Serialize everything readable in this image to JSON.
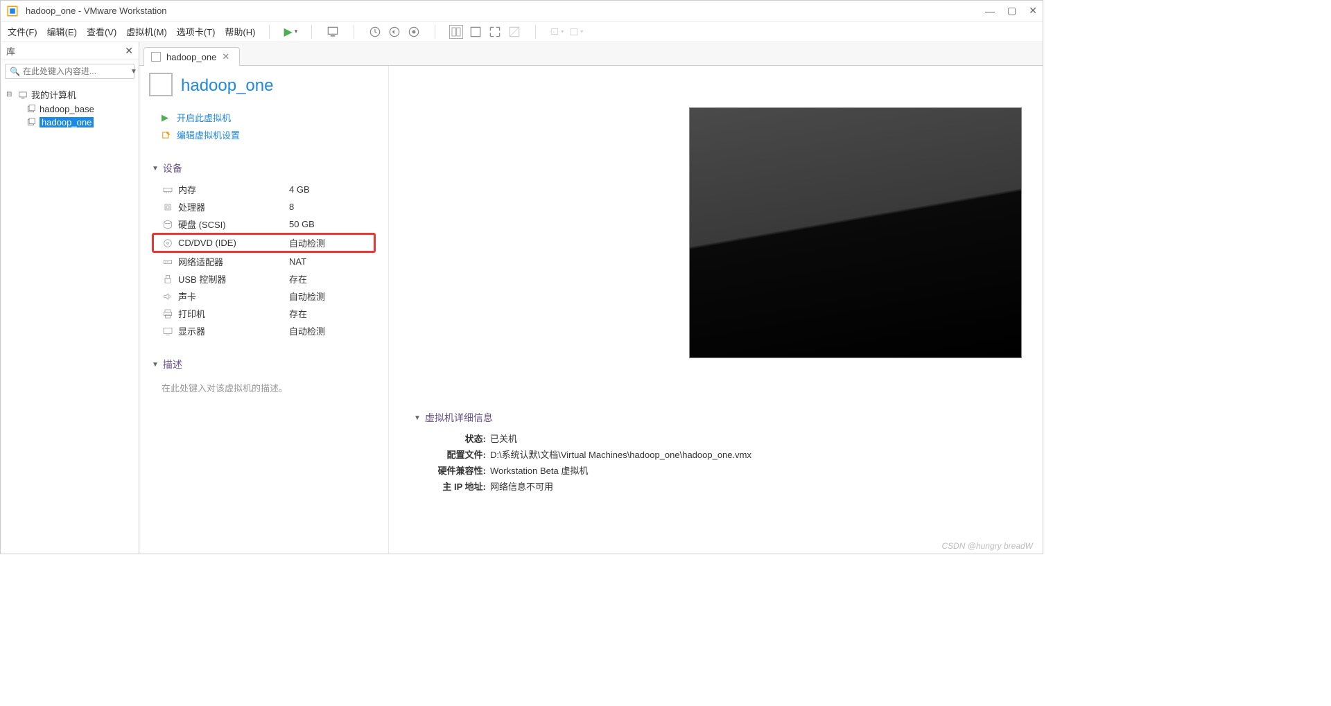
{
  "titlebar": {
    "app_title": "hadoop_one - VMware Workstation"
  },
  "menu": {
    "file": "文件(F)",
    "edit": "编辑(E)",
    "view": "查看(V)",
    "vm": "虚拟机(M)",
    "tabs": "选项卡(T)",
    "help": "帮助(H)"
  },
  "sidebar": {
    "title": "库",
    "search_placeholder": "在此处键入内容进...",
    "root_label": "我的计算机",
    "items": [
      {
        "label": "hadoop_base"
      },
      {
        "label": "hadoop_one"
      }
    ]
  },
  "tab": {
    "label": "hadoop_one"
  },
  "vm": {
    "name": "hadoop_one",
    "actions": {
      "power_on": "开启此虚拟机",
      "edit_settings": "编辑虚拟机设置"
    },
    "sections": {
      "devices": "设备",
      "description": "描述",
      "details": "虚拟机详细信息"
    },
    "hardware": [
      {
        "icon": "memory",
        "name": "内存",
        "value": "4 GB"
      },
      {
        "icon": "cpu",
        "name": "处理器",
        "value": "8"
      },
      {
        "icon": "disk",
        "name": "硬盘 (SCSI)",
        "value": "50 GB"
      },
      {
        "icon": "cd",
        "name": "CD/DVD (IDE)",
        "value": "自动检测",
        "highlighted": true
      },
      {
        "icon": "net",
        "name": "网络适配器",
        "value": "NAT"
      },
      {
        "icon": "usb",
        "name": "USB 控制器",
        "value": "存在"
      },
      {
        "icon": "sound",
        "name": "声卡",
        "value": "自动检测"
      },
      {
        "icon": "printer",
        "name": "打印机",
        "value": "存在"
      },
      {
        "icon": "display",
        "name": "显示器",
        "value": "自动检测"
      }
    ],
    "description_placeholder": "在此处键入对该虚拟机的描述。",
    "details": {
      "state_label": "状态:",
      "state_value": "已关机",
      "config_label": "配置文件:",
      "config_value": "D:\\系统认默\\文档\\Virtual Machines\\hadoop_one\\hadoop_one.vmx",
      "compat_label": "硬件兼容性:",
      "compat_value": "Workstation Beta 虚拟机",
      "ip_label": "主 IP 地址:",
      "ip_value": "网络信息不可用"
    }
  },
  "watermark": "CSDN @hungry breadW"
}
